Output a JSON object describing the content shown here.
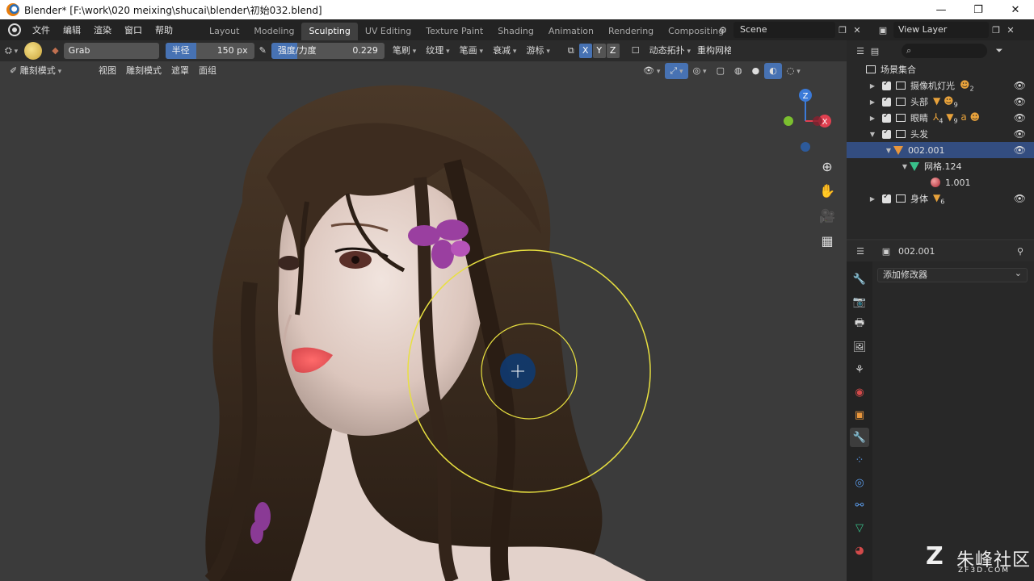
{
  "window": {
    "title": "Blender* [F:\\work\\020 meixing\\shucai\\blender\\初始032.blend]",
    "minimize": "—",
    "maximize": "❐",
    "close": "✕"
  },
  "menu": [
    "文件",
    "编辑",
    "渲染",
    "窗口",
    "帮助"
  ],
  "workspaces": [
    "Layout",
    "Modeling",
    "Sculpting",
    "UV Editing",
    "Texture Paint",
    "Shading",
    "Animation",
    "Rendering",
    "Compositing",
    "Sc"
  ],
  "active_workspace": "Sculpting",
  "scene": {
    "label": "Scene"
  },
  "view_layer": {
    "label": "View Layer"
  },
  "tool_header": {
    "brush_name": "Grab",
    "radius_label": "半径",
    "radius_value": "150 px",
    "strength_label": "强度/力度",
    "strength_value": "0.229",
    "strength_fraction": 0.229,
    "brush_menu": "笔刷",
    "texture_menu": "纹理",
    "stroke_menu": "笔画",
    "falloff_menu": "衰减",
    "cursor_menu": "游标",
    "axis_x": "X",
    "axis_y": "Y",
    "axis_z": "Z",
    "dyntopo": "动态拓扑",
    "remesh": "重构网格"
  },
  "mode_header": {
    "mode": "雕刻模式",
    "view": "视图",
    "sculpt": "雕刻模式",
    "mask": "遮罩",
    "face_sets": "面组"
  },
  "gizmo": {
    "x": "X",
    "y": "Y",
    "z": "Z"
  },
  "outliner": {
    "root": "场景集合",
    "rows": [
      {
        "label": "摄像机灯光",
        "badge": "2",
        "expanded": false,
        "selected": false
      },
      {
        "label": "头部",
        "badge": "9",
        "expanded": false,
        "selected": false
      },
      {
        "label": "眼睛",
        "badge": "4",
        "badge2": "9",
        "expanded": false,
        "selected": false
      },
      {
        "label": "头发",
        "expanded": true,
        "selected": false
      },
      {
        "label": "002.001",
        "expanded": true,
        "selected": true
      },
      {
        "label": "网格.124",
        "expanded": true,
        "selected": false
      },
      {
        "label": "1.001",
        "selected": false
      },
      {
        "label": "身体",
        "badge": "6",
        "expanded": false,
        "selected": false
      }
    ]
  },
  "properties": {
    "object_name": "002.001",
    "add_modifier": "添加修改器"
  },
  "watermark": {
    "logo": "Z",
    "cn": "朱峰社区",
    "en": "ZF3D.COM"
  },
  "colors": {
    "accent": "#4772b3",
    "brush_circle": "#e8e040",
    "hair": "#3b2a1e",
    "skin": "#e8d6cf"
  }
}
